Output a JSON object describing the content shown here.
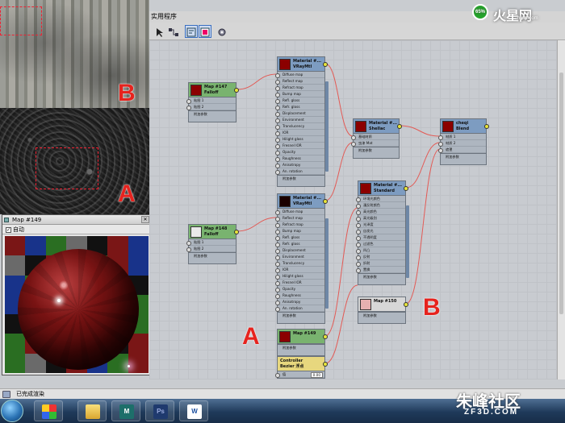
{
  "editor": {
    "title": "实用程序"
  },
  "preview": {
    "title": "Map #149",
    "auto_label": "自动",
    "auto_checked": true
  },
  "annotations": {
    "a": "A",
    "b": "B"
  },
  "statusbar": {
    "text": "已完成渲染"
  },
  "watermark_top": {
    "text": "火星网",
    "sub": "hxsd.com",
    "badge": "65%"
  },
  "watermark_bottom": {
    "text": "朱峰社区",
    "sub": "ZF3D.COM"
  },
  "nodes": {
    "falloff147": {
      "title": "Map #147",
      "subtitle": "Falloff",
      "rows": [
        "贴图 1",
        "贴图 2"
      ],
      "footer": "附加参数"
    },
    "falloff148": {
      "title": "Map #148",
      "subtitle": "Falloff",
      "rows": [
        "贴图 1",
        "贴图 2"
      ],
      "footer": "附加参数"
    },
    "vraymtl1": {
      "title": "Material #...",
      "subtitle": "VRayMtl",
      "rows": [
        "Diffuse map",
        "Reflect map",
        "Refract map",
        "Bump map",
        "Refl. gloss",
        "Refr. gloss",
        "Displacement",
        "Environment",
        "Translucency",
        "IOR",
        "Hilight gloss",
        "Fresnel IOR",
        "Opacity",
        "Roughness",
        "Anisotropy",
        "An. rotation"
      ],
      "footer": "附加参数"
    },
    "vraymtl2": {
      "title": "Material #...",
      "subtitle": "VRayMtl",
      "rows": [
        "Diffuse map",
        "Reflect map",
        "Refract map",
        "Bump map",
        "Refl. gloss",
        "Refr. gloss",
        "Displacement",
        "Environment",
        "Translucency",
        "IOR",
        "Hilight gloss",
        "Fresnel IOR",
        "Opacity",
        "Roughness",
        "Anisotropy",
        "An. rotation"
      ],
      "footer": "附加参数"
    },
    "shellac": {
      "title": "Material #...",
      "subtitle": "Shellac",
      "rows": [
        "基础材质",
        "虫漆 Mat"
      ],
      "footer": "附加参数"
    },
    "blend": {
      "title": "cheqi",
      "subtitle": "Blend",
      "rows": [
        "材质 1",
        "材质 2",
        "遮罩"
      ],
      "footer": "附加参数"
    },
    "standard": {
      "title": "Material #...",
      "subtitle": "Standard",
      "rows": [
        "环境光颜色",
        "漫反射颜色",
        "高光颜色",
        "高光级别",
        "光泽度",
        "自发光",
        "不透明度",
        "过滤色",
        "凹凸",
        "反射",
        "折射",
        "置换"
      ],
      "footer": "附加参数"
    },
    "map149": {
      "title": "Map #149",
      "subtitle": "",
      "rows": [],
      "footer": "附加参数"
    },
    "map150": {
      "title": "Map #150",
      "subtitle": "",
      "rows": [],
      "footer": "附加参数"
    },
    "controller": {
      "title": "Controller",
      "subtitle": "Bezier 浮点",
      "rows": [
        "值"
      ],
      "value": "0.00"
    }
  },
  "icons": {
    "toolbar": [
      "select-icon",
      "hierarchy-icon",
      "layout-icon",
      "show-map-icon",
      "render-icon"
    ],
    "taskbar": [
      "start-orb-icon",
      "media-center-icon",
      "folder-icon",
      "3dsmax-icon",
      "photoshop-icon",
      "word-icon"
    ]
  },
  "colors": {
    "node_header_green": "#79b36f",
    "node_header_blue": "#7d9cc1",
    "node_header_yellow": "#e7d77e",
    "wire": "#e35a55",
    "annotation": "#e6231e"
  }
}
